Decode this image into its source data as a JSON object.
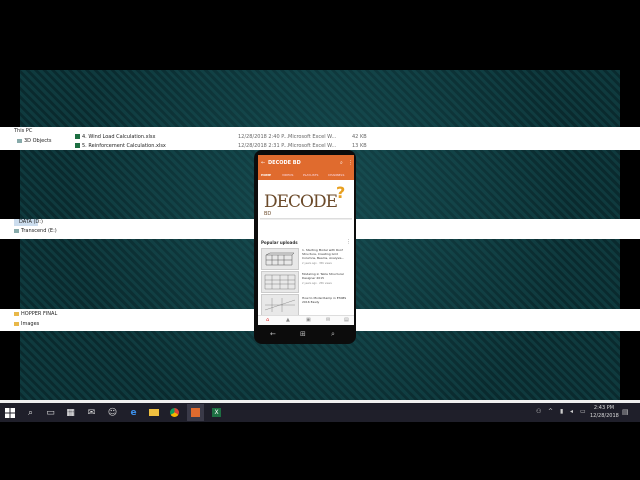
{
  "explorer": {
    "sidebar": {
      "this_pc": "This PC",
      "objects_3d": "3D Objects",
      "data_drive": "DATA (D:)",
      "transcend": "Transcend (E:)",
      "hopper": "HOPPER FINAL",
      "images": "Images"
    },
    "files": [
      {
        "name": "4. Wind Load Calculation.xlsx",
        "date": "12/28/2018 2:40 P...",
        "type": "Microsoft Excel W...",
        "size": "42 KB"
      },
      {
        "name": "5. Reinforcement Calculation.xlsx",
        "date": "12/28/2018 2:31 P...",
        "type": "Microsoft Excel W...",
        "size": "13 KB"
      }
    ]
  },
  "phone": {
    "app_title": "DECODE BD",
    "tabs": [
      "HOME",
      "VIDEOS",
      "PLAYLISTS",
      "CHANNELS"
    ],
    "banner_logo": "DECODE",
    "banner_logo_suffix": "BD",
    "popular_label": "Popular uploads",
    "videos": [
      {
        "title": "1. Starting Model with Roof Structure, Creating Grid Columns, Beams, Analysis...",
        "meta": "2 years ago · 35K views"
      },
      {
        "title": "Modeling in Tekla Structural Designer 2015",
        "meta": "2 years ago · 25K views"
      },
      {
        "title": "How to Model Ramp in ETABS 2016 Easily",
        "meta": ""
      }
    ]
  },
  "taskbar": {
    "time": "2:43 PM",
    "date": "12/28/2018",
    "icons": [
      "windows-icon",
      "search-icon",
      "task-view-icon",
      "store-icon",
      "mail-icon",
      "people-icon",
      "edge-icon",
      "file-explorer-icon",
      "chrome-icon",
      "app-icon",
      "excel-icon"
    ]
  }
}
